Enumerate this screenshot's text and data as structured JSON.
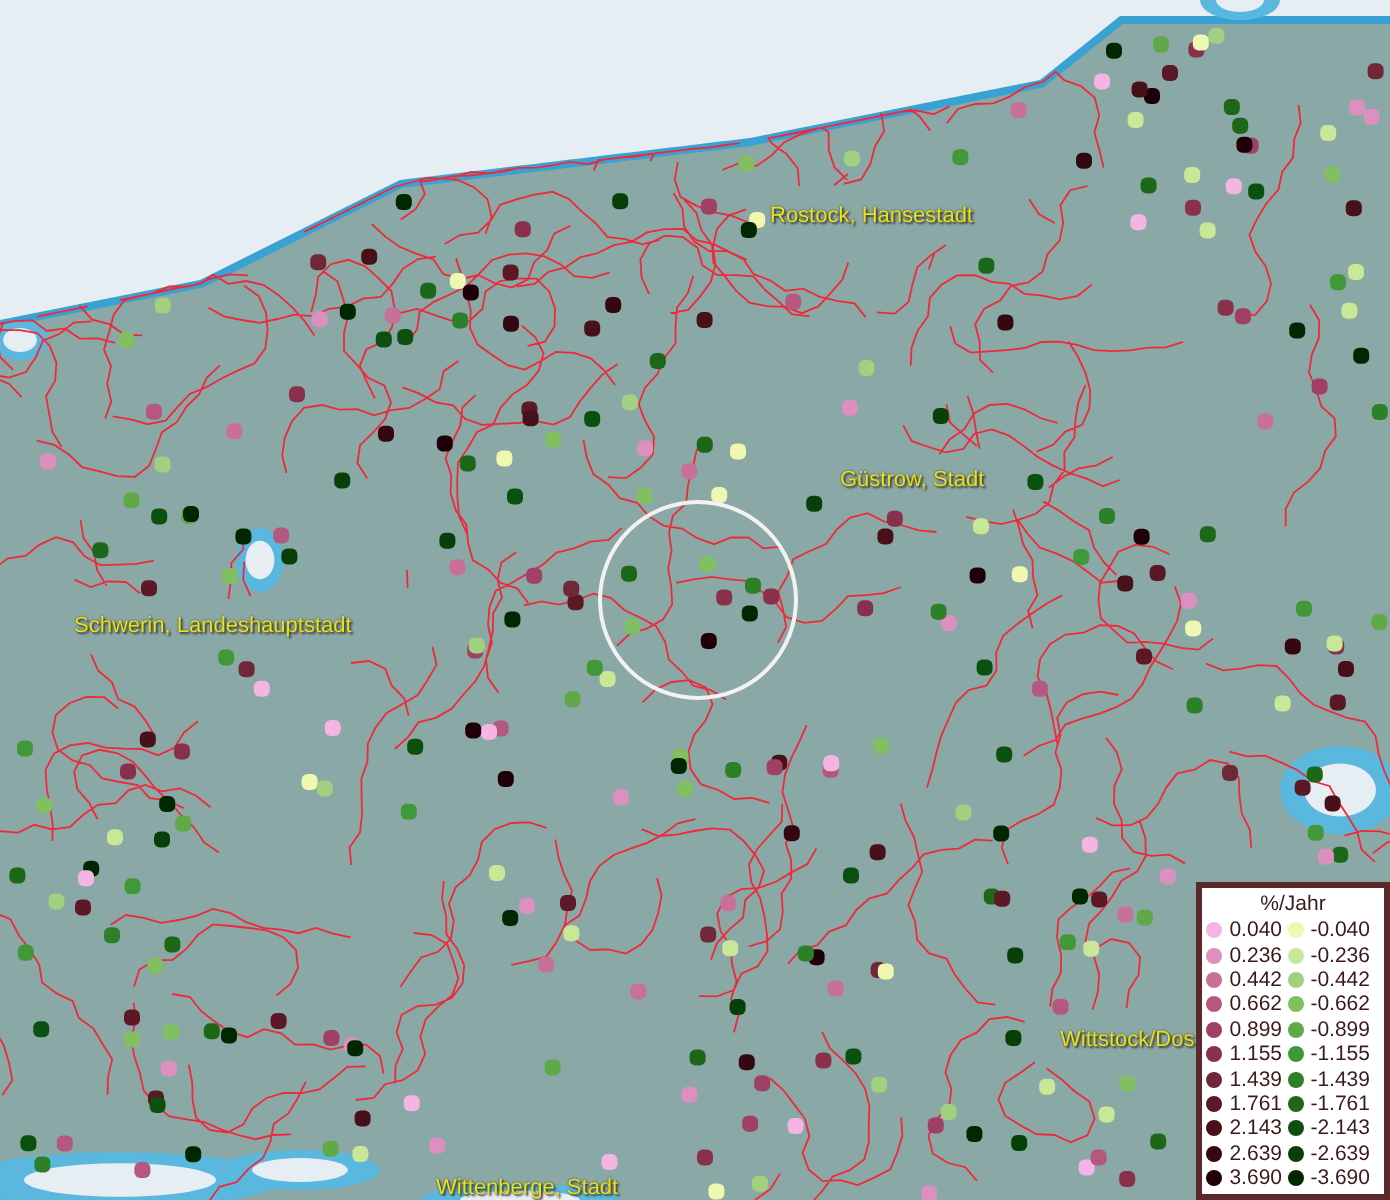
{
  "map": {
    "places": [
      {
        "name": "Rostock, Hansestadt"
      },
      {
        "name": "Güstrow, Stadt"
      },
      {
        "name": "Schwerin, Landeshauptstadt"
      },
      {
        "name": "Wittstock/Dos"
      },
      {
        "name": "Wittenberge, Stadt"
      }
    ]
  },
  "legend": {
    "title": "%/Jahr",
    "positive": [
      {
        "value": "0.040",
        "color": "#f4b4e4"
      },
      {
        "value": "0.236",
        "color": "#dc90c0"
      },
      {
        "value": "0.442",
        "color": "#c87098"
      },
      {
        "value": "0.662",
        "color": "#b45880"
      },
      {
        "value": "0.899",
        "color": "#a04064"
      },
      {
        "value": "1.155",
        "color": "#88304c"
      },
      {
        "value": "1.439",
        "color": "#702838"
      },
      {
        "value": "1.761",
        "color": "#5c1824"
      },
      {
        "value": "2.143",
        "color": "#481018"
      },
      {
        "value": "2.639",
        "color": "#340810"
      },
      {
        "value": "3.690",
        "color": "#200008"
      }
    ],
    "negative": [
      {
        "value": "-0.040",
        "color": "#eef8b0"
      },
      {
        "value": "-0.236",
        "color": "#c8e898"
      },
      {
        "value": "-0.442",
        "color": "#a0d080"
      },
      {
        "value": "-0.662",
        "color": "#80c060"
      },
      {
        "value": "-0.899",
        "color": "#60a848"
      },
      {
        "value": "-1.155",
        "color": "#409838"
      },
      {
        "value": "-1.439",
        "color": "#2c8028"
      },
      {
        "value": "-1.761",
        "color": "#1c6818"
      },
      {
        "value": "-2.143",
        "color": "#0c5010"
      },
      {
        "value": "-2.639",
        "color": "#064008"
      },
      {
        "value": "-3.690",
        "color": "#002800"
      }
    ]
  }
}
